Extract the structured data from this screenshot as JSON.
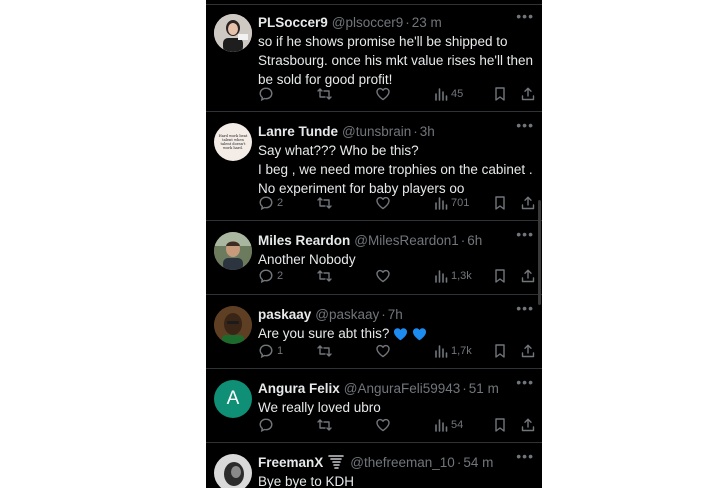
{
  "tweets": [
    {
      "name": "PLSoccer9",
      "handle": "@plsoccer9",
      "time": "23 m",
      "lines": [
        "so if he shows promise he'll be shipped to",
        "Strasbourg. once his mkt value rises he'll then",
        "be sold for good profit!"
      ],
      "replies": "",
      "views": "45"
    },
    {
      "name": "Lanre Tunde",
      "handle": "@tunsbrain",
      "time": "3h",
      "avatar_text": "Hard work beat talent when talent doesn't work hard.",
      "lines": [
        "Say what??? Who be this?",
        "I beg , we need more trophies on the cabinet .",
        "No experiment for baby players oo"
      ],
      "replies": "2",
      "views": "701"
    },
    {
      "name": "Miles Reardon",
      "handle": "@MilesReardon1",
      "time": "6h",
      "lines": [
        "Another Nobody"
      ],
      "replies": "2",
      "views": "1,3k"
    },
    {
      "name": "paskaay",
      "handle": "@paskaay",
      "time": "7h",
      "lines": [
        "Are you sure abt this?"
      ],
      "emoji_count": 2,
      "replies": "1",
      "views": "1,7k"
    },
    {
      "name": "Angura Felix",
      "handle": "@AnguraFeli59943",
      "time": "51 m",
      "avatar_letter": "A",
      "lines": [
        "We really loved ubro"
      ],
      "replies": "",
      "views": "54"
    },
    {
      "name": "FreemanX",
      "handle": "@thefreeman_10",
      "time": "54 m",
      "lines": [
        "Bye bye to KDH"
      ]
    }
  ],
  "colors": {
    "background": "#000000",
    "text": "#e7e9ea",
    "muted": "#71767b",
    "divider": "#2f3336",
    "angura_avatar": "#0f8f75",
    "heart_emoji": "#1d8cf0"
  },
  "icons": [
    "reply-icon",
    "retweet-icon",
    "like-icon",
    "views-icon",
    "bookmark-icon",
    "share-icon",
    "more-icon"
  ]
}
